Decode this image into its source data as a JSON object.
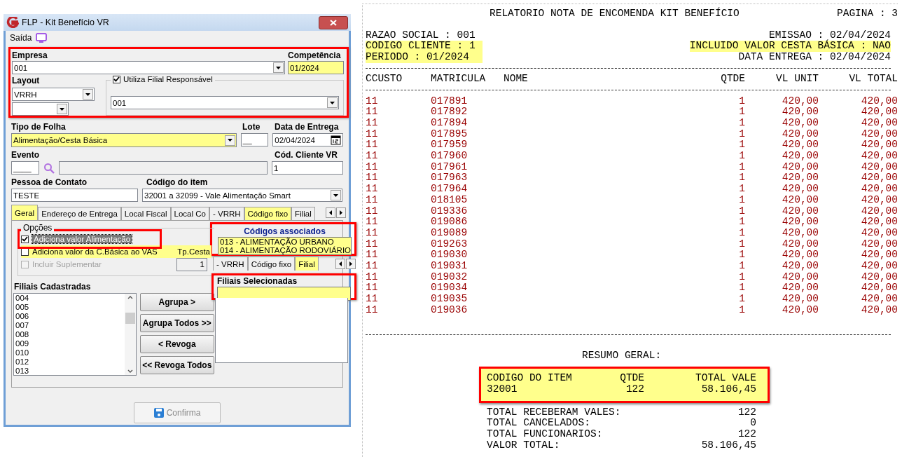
{
  "window": {
    "title": "FLP - Kit Benefício VR"
  },
  "menu": [
    {
      "label": "Saída"
    }
  ],
  "empresa": {
    "label": "Empresa",
    "value": "001"
  },
  "competencia": {
    "label": "Competência",
    "value": "01/2024",
    "highlighted": true
  },
  "layout": {
    "label": "Layout",
    "value": "VRRH"
  },
  "utiliza_filial": {
    "label": "Utiliza Filial Responsável",
    "checked": true,
    "value": "001"
  },
  "tipo_folha": {
    "label": "Tipo de Folha",
    "value": "Alimentação/Cesta Básica",
    "highlighted": true
  },
  "lote": {
    "label": "Lote",
    "value": "__"
  },
  "data_entrega": {
    "label": "Data de Entrega",
    "value": "02/04/2024"
  },
  "evento": {
    "label": "Evento",
    "value": "____"
  },
  "cod_cliente": {
    "label": "Cód. Cliente VR",
    "value": "1"
  },
  "pessoa_contato": {
    "label": "Pessoa de Contato",
    "value": "TESTE"
  },
  "codigo_item": {
    "label": "Código do item",
    "value": "32001 a 32099 - Vale Alimentação Smart"
  },
  "tabs": [
    {
      "label": "Geral",
      "selected": true,
      "highlighted": true
    },
    {
      "label": "Endereço de Entrega",
      "selected": false,
      "highlighted": false
    },
    {
      "label": "Local Fiscal",
      "selected": false,
      "highlighted": false
    },
    {
      "label": "Local Co",
      "selected": false,
      "highlighted": false
    },
    {
      "label": "- VRRH",
      "selected": false,
      "highlighted": false
    },
    {
      "label": "Código fixo",
      "selected": false,
      "highlighted": true
    },
    {
      "label": "Filial",
      "selected": false,
      "highlighted": false
    }
  ],
  "options": {
    "title": "Opções",
    "items": [
      {
        "label": "Adiciona valor Alimentação",
        "checked": true,
        "disabled": false,
        "focused": true,
        "highlighted": false
      },
      {
        "label": "Adiciona valor da C.Básica ao VAS",
        "checked": false,
        "disabled": false,
        "focused": false,
        "highlighted": true
      },
      {
        "label": "Incluir Suplementar",
        "checked": false,
        "disabled": true,
        "focused": false,
        "highlighted": false
      }
    ]
  },
  "tp_cesta": {
    "label": "Tp.Cesta",
    "value": "1"
  },
  "codigos_associados": {
    "title": "Códigos associados",
    "items": [
      "013 - ALIMENTAÇÃO URBANO",
      "014 - ALIMENTAÇÃO RODOVIÁRIO"
    ]
  },
  "inner_tabs": [
    {
      "label": "- VRRH",
      "selected": false
    },
    {
      "label": "Código fixo",
      "selected": false
    },
    {
      "label": "Filial",
      "selected": true
    }
  ],
  "filiais_cadastradas": {
    "title": "Filiais Cadastradas",
    "items": [
      "004",
      "005",
      "006",
      "007",
      "008",
      "009",
      "010",
      "012",
      "013"
    ]
  },
  "actions": [
    "Agrupa >",
    "Agrupa Todos >>",
    "< Revoga",
    "<< Revoga Todos"
  ],
  "filiais_selecionadas": {
    "title": "Filiais Selecionadas"
  },
  "confirm_button": {
    "label": "Confirma",
    "disabled": true
  },
  "report": {
    "title": "RELATORIO NOTA DE ENCOMENDA KIT BENEFÍCIO",
    "page": "PAGINA  : 3",
    "info_left": [
      {
        "text": "RAZAO SOCIAL : 001",
        "highlighted": false
      },
      {
        "text": "CODIGO CLIENTE : 1",
        "highlighted": true
      },
      {
        "text": "PERIODO : 01/2024",
        "highlighted": true
      }
    ],
    "info_right": [
      {
        "text": "EMISSAO : 02/04/2024",
        "highlighted": false
      },
      {
        "text": "INCLUIDO VALOR CESTA BÁSICA : NAO",
        "highlighted": true
      },
      {
        "text": "DATA ENTREGA : 02/04/2024",
        "highlighted": false
      }
    ],
    "columns": [
      "CCUSTO",
      "MATRICULA",
      "NOME",
      "QTDE",
      "VL UNIT",
      "VL TOTAL"
    ],
    "rows": [
      {
        "ccusto": "11",
        "matricula": "017891",
        "qtde": "1",
        "vl_unit": "420,00",
        "vl_total": "420,00"
      },
      {
        "ccusto": "11",
        "matricula": "017892",
        "qtde": "1",
        "vl_unit": "420,00",
        "vl_total": "420,00"
      },
      {
        "ccusto": "11",
        "matricula": "017894",
        "qtde": "1",
        "vl_unit": "420,00",
        "vl_total": "420,00"
      },
      {
        "ccusto": "11",
        "matricula": "017895",
        "qtde": "1",
        "vl_unit": "420,00",
        "vl_total": "420,00"
      },
      {
        "ccusto": "11",
        "matricula": "017959",
        "qtde": "1",
        "vl_unit": "420,00",
        "vl_total": "420,00"
      },
      {
        "ccusto": "11",
        "matricula": "017960",
        "qtde": "1",
        "vl_unit": "420,00",
        "vl_total": "420,00"
      },
      {
        "ccusto": "11",
        "matricula": "017961",
        "qtde": "1",
        "vl_unit": "420,00",
        "vl_total": "420,00"
      },
      {
        "ccusto": "11",
        "matricula": "017963",
        "qtde": "1",
        "vl_unit": "420,00",
        "vl_total": "420,00"
      },
      {
        "ccusto": "11",
        "matricula": "017964",
        "qtde": "1",
        "vl_unit": "420,00",
        "vl_total": "420,00"
      },
      {
        "ccusto": "11",
        "matricula": "018105",
        "qtde": "1",
        "vl_unit": "420,00",
        "vl_total": "420,00"
      },
      {
        "ccusto": "11",
        "matricula": "019336",
        "qtde": "1",
        "vl_unit": "420,00",
        "vl_total": "420,00"
      },
      {
        "ccusto": "11",
        "matricula": "019086",
        "qtde": "1",
        "vl_unit": "420,00",
        "vl_total": "420,00"
      },
      {
        "ccusto": "11",
        "matricula": "019089",
        "qtde": "1",
        "vl_unit": "420,00",
        "vl_total": "420,00"
      },
      {
        "ccusto": "11",
        "matricula": "019263",
        "qtde": "1",
        "vl_unit": "420,00",
        "vl_total": "420,00"
      },
      {
        "ccusto": "11",
        "matricula": "019030",
        "qtde": "1",
        "vl_unit": "420,00",
        "vl_total": "420,00"
      },
      {
        "ccusto": "11",
        "matricula": "019031",
        "qtde": "1",
        "vl_unit": "420,00",
        "vl_total": "420,00"
      },
      {
        "ccusto": "11",
        "matricula": "019032",
        "qtde": "1",
        "vl_unit": "420,00",
        "vl_total": "420,00"
      },
      {
        "ccusto": "11",
        "matricula": "019034",
        "qtde": "1",
        "vl_unit": "420,00",
        "vl_total": "420,00"
      },
      {
        "ccusto": "11",
        "matricula": "019035",
        "qtde": "1",
        "vl_unit": "420,00",
        "vl_total": "420,00"
      },
      {
        "ccusto": "11",
        "matricula": "019036",
        "qtde": "1",
        "vl_unit": "420,00",
        "vl_total": "420,00"
      }
    ],
    "summary_title": "RESUMO GERAL:",
    "summary_columns": [
      "CODIGO DO ITEM",
      "QTDE",
      "TOTAL VALE"
    ],
    "summary_row": [
      "32001",
      "122",
      "58.106,45"
    ],
    "totals": [
      {
        "label": "TOTAL RECEBERAM VALES:",
        "value": "122"
      },
      {
        "label": "TOTAL CANCELADOS:",
        "value": "0"
      },
      {
        "label": "TOTAL FUNCIONARIOS:",
        "value": "122"
      },
      {
        "label": "VALOR TOTAL:",
        "value": "58.106,45"
      }
    ]
  }
}
